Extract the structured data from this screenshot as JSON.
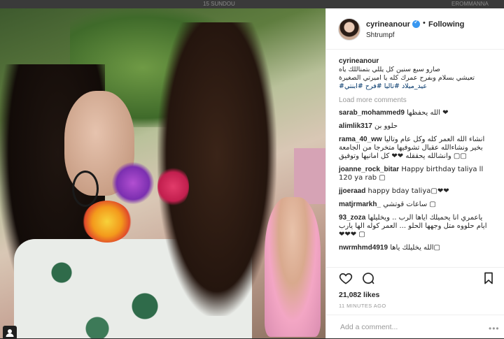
{
  "topstrip": {
    "left_text": "15 SUNDOU",
    "right_text": "EROMMANNA"
  },
  "post": {
    "username": "cyrineanour",
    "follow_label": "Following",
    "separator": "•",
    "location": "Shtrumpf",
    "caption": {
      "user": "cyrineanour",
      "line1": "صارو سبع سنين كل يللي بتمناللك ياه",
      "line2": "تعيشي بسلام وبفرح عمرك كله يا اميرتي الصغيرة",
      "line3": "#عيد_ميلاد #تاليا #فرح #ابنتي"
    },
    "load_more": "Load more comments",
    "comments": [
      {
        "user": "sarab_mohammed9",
        "text": "الله يحفظها ❤"
      },
      {
        "user": "alimlik317",
        "text": "حلوو بن"
      },
      {
        "user": "rama_40_ww",
        "text": "انشاء الله العمر كله وكل عام وتاليا بخير ونشاءالله عقبال تشوفيها متخرجا من الجامعة وانشالله يحققله ❤❤ كل امانيها وتوفيق ▢▢"
      },
      {
        "user": "joanne_rock_bitar",
        "text": "Happy birthday taliya ll 120 ya rab ▢"
      },
      {
        "user": "jjoeraad",
        "text": "happy bday taliya▢❤❤"
      },
      {
        "user": "matjrmarkh_",
        "text": "ساعات قوتشي ▢"
      },
      {
        "user": "93_zoza",
        "text": "ياعمري انا يحميلك اياها الرب .. ويخليلها ايام حلووه متل وجهها الحلو ... العمر كوله الها يارب ❤❤❤ ▢"
      },
      {
        "user": "nwrmhmd4919",
        "text": "الله يخليلك ياها▢"
      }
    ],
    "likes": "21,082 likes",
    "time": "11 MINUTES AGO",
    "add_comment_placeholder": "Add a comment...",
    "more": "•••"
  },
  "icons": {
    "like": "heart-icon",
    "comment": "comment-bubble-icon",
    "save": "bookmark-icon",
    "verified": "verified-badge-icon",
    "user_tag": "person-tag-icon"
  },
  "colors": {
    "verified": "#3897f0",
    "text": "#262626",
    "muted": "#999999"
  }
}
